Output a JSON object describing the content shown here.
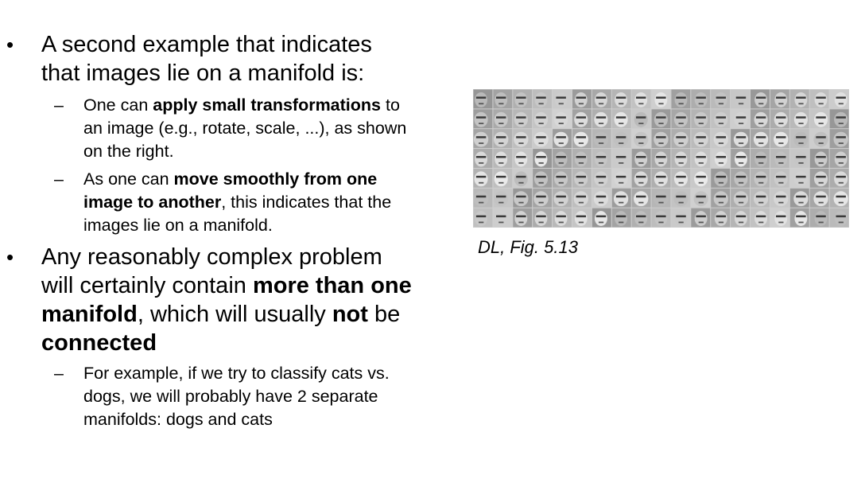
{
  "bullet1": {
    "marker": "•",
    "text": "A second example that indicates that images lie on a manifold is:",
    "subs": [
      {
        "marker": "–",
        "pre": "One can ",
        "bold": "apply small transformations",
        "post": " to an image (e.g., rotate, scale, ...), as shown on the right."
      },
      {
        "marker": "–",
        "pre": "As one can ",
        "bold": "move smoothly from one image to another",
        "post": ", this indicates that the images lie on a manifold."
      }
    ]
  },
  "bullet2": {
    "marker": "•",
    "pre": "Any reasonably complex problem will certainly contain ",
    "bold1": "more than one manifold",
    "mid": ", which will usually ",
    "bold2": "not",
    "mid2": " be ",
    "bold3": "connected",
    "sub": {
      "marker": "–",
      "text": "For example, if we try to classify cats vs. dogs, we will probably have 2 separate manifolds: dogs and cats"
    }
  },
  "figure": {
    "caption": "DL, Fig. 5.13",
    "rows": 7,
    "cols": 19
  }
}
